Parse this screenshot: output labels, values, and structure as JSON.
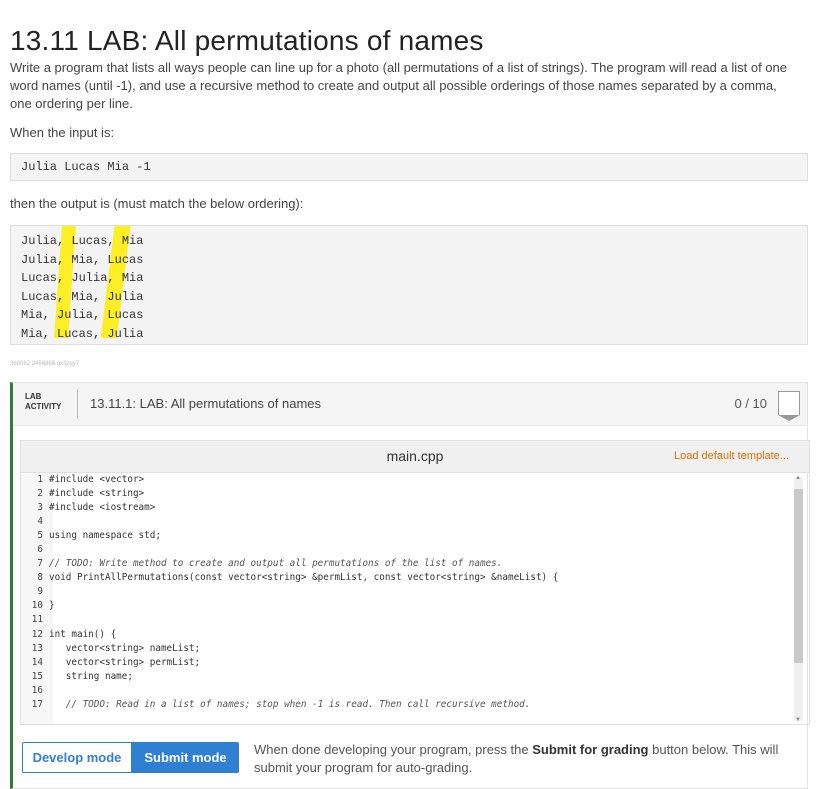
{
  "page": {
    "title": "13.11 LAB: All permutations of names",
    "description": "Write a program that lists all ways people can line up for a photo (all permutations of a list of strings). The program will read a list of one word names (until -1), and use a recursive method to create and output all possible orderings of those names separated by a comma, one ordering per line.",
    "when_input": "When the input is:",
    "input_example": "Julia Lucas Mia -1",
    "then_output": "then the output is (must match the below ordering):",
    "output_lines": [
      "Julia, Lucas, Mia",
      "Julia, Mia, Lucas",
      "Lucas, Julia, Mia",
      "Lucas, Mia, Julia",
      "Mia, Julia, Lucas",
      "Mia, Lucas, Julia"
    ],
    "small_id": "368082.2456868.qx3zqy7"
  },
  "lab": {
    "tag_line1": "LAB",
    "tag_line2": "ACTIVITY",
    "title": "13.11.1: LAB: All permutations of names",
    "score": "0 / 10"
  },
  "editor": {
    "filename": "main.cpp",
    "load_template": "Load default template...",
    "lines": [
      {
        "n": "1",
        "text": "#include <vector>",
        "comment": false
      },
      {
        "n": "2",
        "text": "#include <string>",
        "comment": false
      },
      {
        "n": "3",
        "text": "#include <iostream>",
        "comment": false
      },
      {
        "n": "4",
        "text": "",
        "comment": false
      },
      {
        "n": "5",
        "text": "using namespace std;",
        "comment": false
      },
      {
        "n": "6",
        "text": "",
        "comment": false
      },
      {
        "n": "7",
        "text": "// TODO: Write method to create and output all permutations of the list of names.",
        "comment": true
      },
      {
        "n": "8",
        "text": "void PrintAllPermutations(const vector<string> &permList, const vector<string> &nameList) {",
        "comment": false
      },
      {
        "n": "9",
        "text": "",
        "comment": false
      },
      {
        "n": "10",
        "text": "}",
        "comment": false
      },
      {
        "n": "11",
        "text": "",
        "comment": false
      },
      {
        "n": "12",
        "text": "int main() {",
        "comment": false
      },
      {
        "n": "13",
        "text": "   vector<string> nameList;",
        "comment": false
      },
      {
        "n": "14",
        "text": "   vector<string> permList;",
        "comment": false
      },
      {
        "n": "15",
        "text": "   string name;",
        "comment": false
      },
      {
        "n": "16",
        "text": "",
        "comment": false
      },
      {
        "n": "17",
        "text": "   // TODO: Read in a list of names; stop when -1 is read. Then call recursive method.",
        "comment": true
      }
    ]
  },
  "footer": {
    "develop_mode": "Develop mode",
    "submit_mode": "Submit mode",
    "note_before": "When done developing your program, press the ",
    "note_bold": "Submit for grading",
    "note_after": " button below. This will submit your program for auto-grading."
  },
  "colors": {
    "accent_blue": "#2f7fd2",
    "link_orange": "#e07000",
    "lab_bar_green": "#2e7d32",
    "highlight_yellow": "#ffec00"
  }
}
